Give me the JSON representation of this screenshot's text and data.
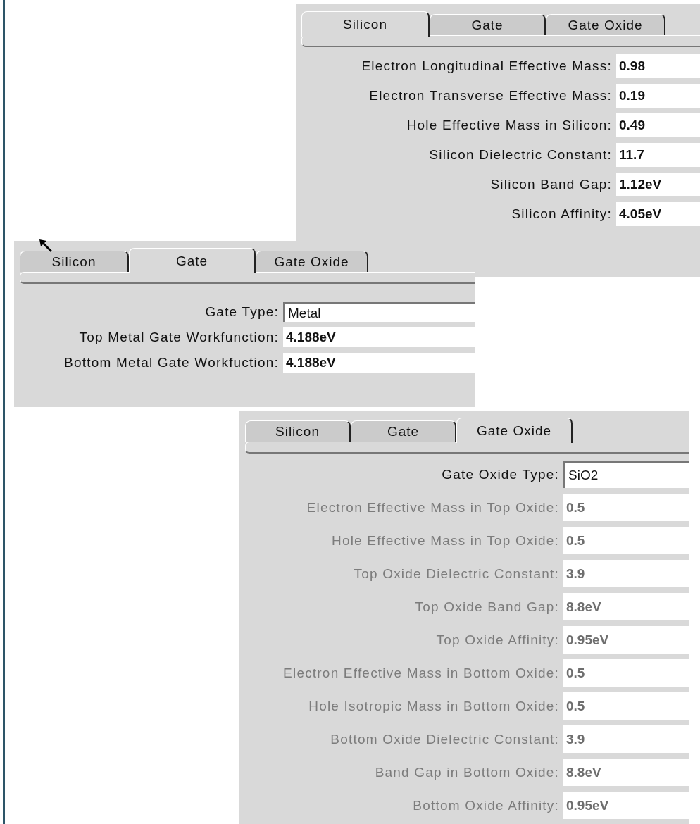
{
  "panels": [
    {
      "tabs": [
        {
          "label": "Silicon",
          "selected": true
        },
        {
          "label": "Gate",
          "selected": false
        },
        {
          "label": "Gate Oxide",
          "selected": false
        }
      ],
      "rows": [
        {
          "label": "Electron Longitudinal Effective Mass:",
          "value": "0.98",
          "kind": "value",
          "disabled": false
        },
        {
          "label": "Electron Transverse Effective Mass:",
          "value": "0.19",
          "kind": "value",
          "disabled": false
        },
        {
          "label": "Hole Effective Mass in Silicon:",
          "value": "0.49",
          "kind": "value",
          "disabled": false
        },
        {
          "label": "Silicon Dielectric Constant:",
          "value": "11.7",
          "kind": "value",
          "disabled": false
        },
        {
          "label": "Silicon Band Gap:",
          "value": "1.12eV",
          "kind": "value",
          "disabled": false
        },
        {
          "label": "Silicon Affinity:",
          "value": "4.05eV",
          "kind": "value",
          "disabled": false
        }
      ]
    },
    {
      "tabs": [
        {
          "label": "Silicon",
          "selected": false
        },
        {
          "label": "Gate",
          "selected": true
        },
        {
          "label": "Gate Oxide",
          "selected": false
        }
      ],
      "rows": [
        {
          "label": "Gate Type:",
          "value": "Metal",
          "kind": "input",
          "disabled": false
        },
        {
          "label": "Top Metal Gate Workfunction:",
          "value": "4.188eV",
          "kind": "value",
          "disabled": false
        },
        {
          "label": "Bottom Metal Gate Workfuction:",
          "value": "4.188eV",
          "kind": "value",
          "disabled": false
        }
      ]
    },
    {
      "tabs": [
        {
          "label": "Silicon",
          "selected": false
        },
        {
          "label": "Gate",
          "selected": false
        },
        {
          "label": "Gate Oxide",
          "selected": true
        }
      ],
      "rows": [
        {
          "label": "Gate Oxide Type:",
          "value": "SiO2",
          "kind": "input",
          "disabled": false
        },
        {
          "label": "Electron Effective Mass in Top Oxide:",
          "value": "0.5",
          "kind": "value",
          "disabled": true
        },
        {
          "label": "Hole Effective Mass in Top Oxide:",
          "value": "0.5",
          "kind": "value",
          "disabled": true
        },
        {
          "label": "Top Oxide Dielectric Constant:",
          "value": "3.9",
          "kind": "value",
          "disabled": true
        },
        {
          "label": "Top Oxide Band Gap:",
          "value": "8.8eV",
          "kind": "value",
          "disabled": true
        },
        {
          "label": "Top Oxide Affinity:",
          "value": "0.95eV",
          "kind": "value",
          "disabled": true
        },
        {
          "label": "Electron Effective Mass in Bottom Oxide:",
          "value": "0.5",
          "kind": "value",
          "disabled": true
        },
        {
          "label": "Hole Isotropic Mass in Bottom Oxide:",
          "value": "0.5",
          "kind": "value",
          "disabled": true
        },
        {
          "label": "Bottom Oxide Dielectric Constant:",
          "value": "3.9",
          "kind": "value",
          "disabled": true
        },
        {
          "label": "Band Gap in Bottom Oxide:",
          "value": "8.8eV",
          "kind": "value",
          "disabled": true
        },
        {
          "label": "Bottom Oxide Affinity:",
          "value": "0.95eV",
          "kind": "value",
          "disabled": true
        }
      ]
    }
  ]
}
